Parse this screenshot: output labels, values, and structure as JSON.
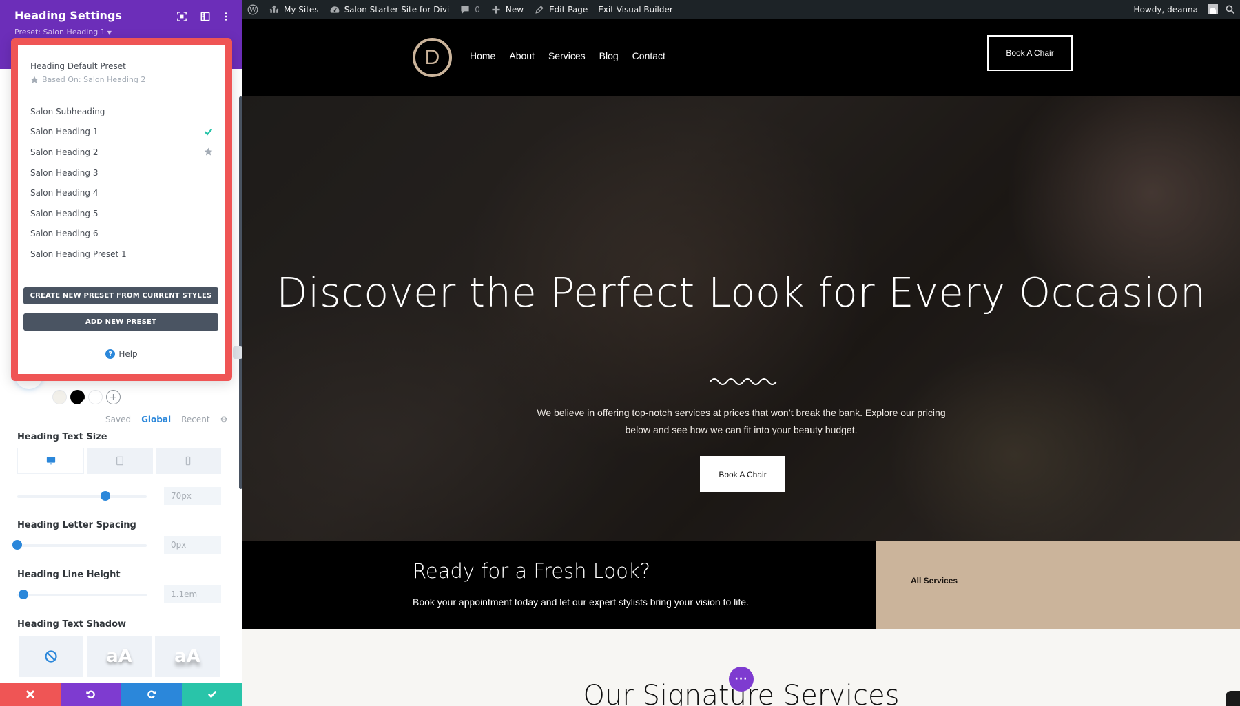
{
  "sidebar": {
    "title": "Heading Settings",
    "preset_label": "Preset: Salon Heading 1",
    "header_icons": [
      "expand-icon",
      "split-view-icon",
      "more-options-icon"
    ],
    "color_tabs": {
      "saved": "Saved",
      "global": "Global",
      "recent": "Recent",
      "active": "Global"
    },
    "swatches": [
      "#f2f0ea",
      "#000000",
      "#ffffff"
    ],
    "fields": {
      "text_size": {
        "label": "Heading Text Size",
        "value": "70px",
        "slider_fraction": 0.68
      },
      "letter_spacing": {
        "label": "Heading Letter Spacing",
        "value": "0px",
        "slider_fraction": 0.0
      },
      "line_height": {
        "label": "Heading Line Height",
        "value": "1.1em",
        "slider_fraction": 0.05
      },
      "text_shadow": {
        "label": "Heading Text Shadow",
        "option_text": "aA"
      }
    },
    "devices": [
      "desktop",
      "tablet",
      "phone"
    ],
    "active_device": "desktop",
    "footer": {
      "cancel": "cancel",
      "undo": "undo",
      "redo": "redo",
      "save": "save"
    },
    "colors": {
      "header": "#6c2eb9",
      "accent": "#2b87da",
      "cancel": "#ef5555",
      "undo": "#7e3bd0",
      "redo": "#2b87da",
      "save": "#29c4a9"
    }
  },
  "preset_popup": {
    "default_preset": "Heading Default Preset",
    "based_on": "Based On: Salon Heading 2",
    "items": [
      {
        "label": "Salon Subheading",
        "mark": ""
      },
      {
        "label": "Salon Heading 1",
        "mark": "check"
      },
      {
        "label": "Salon Heading 2",
        "mark": "star"
      },
      {
        "label": "Salon Heading 3",
        "mark": ""
      },
      {
        "label": "Salon Heading 4",
        "mark": ""
      },
      {
        "label": "Salon Heading 5",
        "mark": ""
      },
      {
        "label": "Salon Heading 6",
        "mark": ""
      },
      {
        "label": "Salon Heading Preset 1",
        "mark": ""
      }
    ],
    "create_button": "CREATE NEW PRESET FROM CURRENT STYLES",
    "add_button": "ADD NEW PRESET",
    "help": "Help",
    "highlight_color": "#ef5555"
  },
  "adminbar": {
    "my_sites": "My Sites",
    "site_name": "Salon Starter Site for Divi",
    "comments_count": "0",
    "new": "New",
    "edit_page": "Edit Page",
    "exit_builder": "Exit Visual Builder",
    "howdy": "Howdy, deanna"
  },
  "site": {
    "logo_letter": "D",
    "nav": [
      "Home",
      "About",
      "Services",
      "Blog",
      "Contact"
    ],
    "header_cta": "Book A Chair",
    "hero": {
      "title": "Discover the Perfect Look for Every Occasion",
      "body": "We believe in offering top-notch services at prices that won’t break the bank. Explore our pricing below and see how we can fit into your beauty budget.",
      "cta": "Book A Chair"
    },
    "cta_band": {
      "title": "Ready for a Fresh Look?",
      "body": "Book your appointment today and let our expert stylists bring your vision to life.",
      "link": "All Services"
    },
    "services_title": "Our Signature Services",
    "colors": {
      "brand_tan": "#cbb49b",
      "builder_purple": "#7e3bd0"
    }
  }
}
